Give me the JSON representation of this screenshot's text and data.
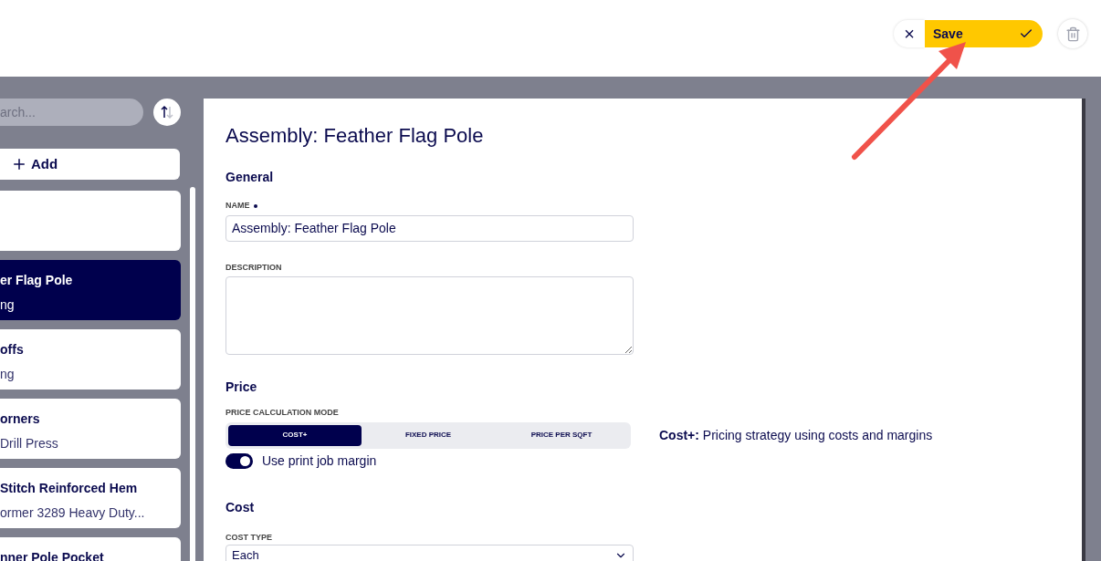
{
  "header": {
    "cancel_icon": "×",
    "save_label": "Save"
  },
  "sidebar": {
    "search": {
      "placeholder": "arch..."
    },
    "add_label": "Add",
    "items": [
      {
        "selected": false
      },
      {
        "title": "er Flag Pole",
        "subtitle": "ng",
        "selected": true
      },
      {
        "title": "offs",
        "subtitle": "ng",
        "selected": false
      },
      {
        "title": "orners",
        "subtitle": "Drill Press",
        "selected": false
      },
      {
        "title": "Stitch Reinforced Hem",
        "subtitle": "ormer 3289 Heavy Duty...",
        "selected": false
      },
      {
        "title": "nner Pole Pocket",
        "selected": false
      }
    ]
  },
  "form": {
    "title": "Assembly: Feather Flag Pole",
    "general": {
      "heading": "General",
      "name_label": "NAME",
      "name_required": true,
      "name_value": "Assembly: Feather Flag Pole",
      "description_label": "DESCRIPTION"
    },
    "price": {
      "heading": "Price",
      "mode_label": "PRICE CALCULATION MODE",
      "modes": [
        {
          "label": "COST+",
          "selected": true
        },
        {
          "label": "FIXED PRICE",
          "selected": false
        },
        {
          "label": "PRICE PER SQFT",
          "selected": false
        }
      ],
      "toggle": {
        "label": "Use print job margin",
        "on": true
      },
      "help": "**Cost+:** Pricing strategy using costs and margins"
    },
    "cost": {
      "heading": "Cost",
      "type_label": "COST TYPE",
      "type_value": "Each"
    }
  }
}
